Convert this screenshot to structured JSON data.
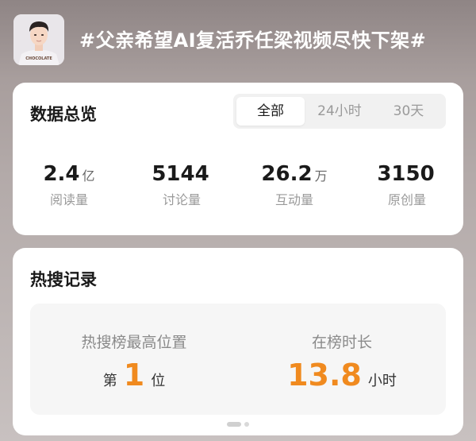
{
  "header": {
    "topic_title": "#父亲希望AI复活乔任梁视频尽快下架#",
    "avatar_shirt_text": "CHOCOLATE"
  },
  "overview": {
    "title": "数据总览",
    "tabs": [
      {
        "label": "全部",
        "active": true
      },
      {
        "label": "24小时",
        "active": false
      },
      {
        "label": "30天",
        "active": false
      }
    ],
    "stats": [
      {
        "value": "2.4",
        "unit": "亿",
        "label": "阅读量"
      },
      {
        "value": "5144",
        "unit": "",
        "label": "讨论量"
      },
      {
        "value": "26.2",
        "unit": "万",
        "label": "互动量"
      },
      {
        "value": "3150",
        "unit": "",
        "label": "原创量"
      }
    ]
  },
  "hot_search": {
    "title": "热搜记录",
    "peak": {
      "label": "热搜榜最高位置",
      "prefix": "第",
      "value": "1",
      "suffix": "位"
    },
    "duration": {
      "label": "在榜时长",
      "value": "13.8",
      "unit": "小时"
    }
  },
  "colors": {
    "accent_orange": "#f08a1f",
    "header_text": "#ffffff"
  }
}
